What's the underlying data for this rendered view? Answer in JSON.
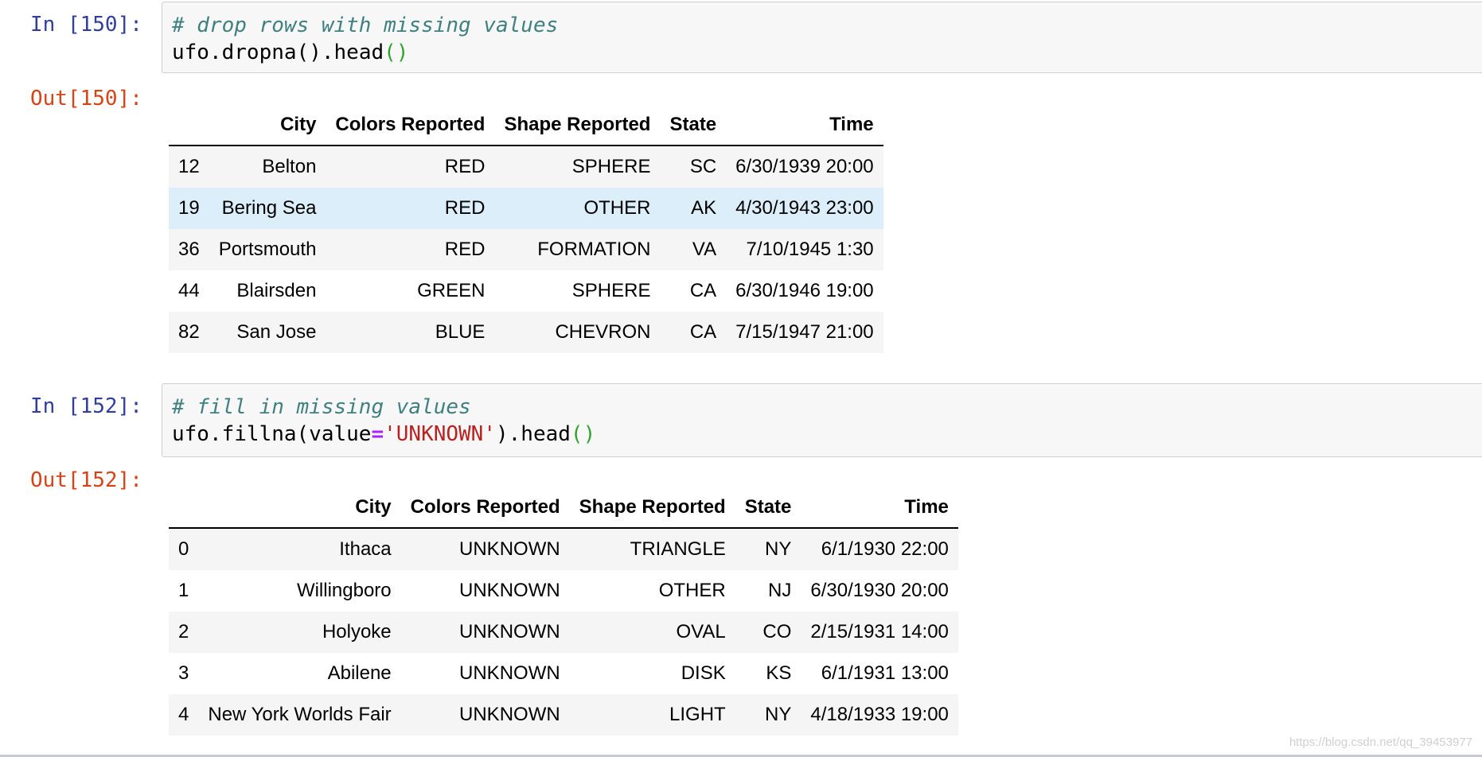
{
  "cells": [
    {
      "in_prompt": "In [150]:",
      "comment": "# drop rows with missing values",
      "code": {
        "obj": "ufo.dropna",
        "p1": "()",
        "mid": ".head",
        "p2": "()"
      },
      "out_prompt": "Out[150]:",
      "table": {
        "columns": [
          "",
          "City",
          "Colors Reported",
          "Shape Reported",
          "State",
          "Time"
        ],
        "rows": [
          [
            "12",
            "Belton",
            "RED",
            "SPHERE",
            "SC",
            "6/30/1939 20:00"
          ],
          [
            "19",
            "Bering Sea",
            "RED",
            "OTHER",
            "AK",
            "4/30/1943 23:00"
          ],
          [
            "36",
            "Portsmouth",
            "RED",
            "FORMATION",
            "VA",
            "7/10/1945 1:30"
          ],
          [
            "44",
            "Blairsden",
            "GREEN",
            "SPHERE",
            "CA",
            "6/30/1946 19:00"
          ],
          [
            "82",
            "San Jose",
            "BLUE",
            "CHEVRON",
            "CA",
            "7/15/1947 21:00"
          ]
        ],
        "highlighted_row": 1
      }
    },
    {
      "in_prompt": "In [152]:",
      "comment": "# fill in missing values",
      "code": {
        "a": "ufo.fillna(value",
        "op": "=",
        "str": "'UNKNOWN'",
        "b": ").head",
        "p": "()"
      },
      "out_prompt": "Out[152]:",
      "table": {
        "columns": [
          "",
          "City",
          "Colors Reported",
          "Shape Reported",
          "State",
          "Time"
        ],
        "rows": [
          [
            "0",
            "Ithaca",
            "UNKNOWN",
            "TRIANGLE",
            "NY",
            "6/1/1930 22:00"
          ],
          [
            "1",
            "Willingboro",
            "UNKNOWN",
            "OTHER",
            "NJ",
            "6/30/1930 20:00"
          ],
          [
            "2",
            "Holyoke",
            "UNKNOWN",
            "OVAL",
            "CO",
            "2/15/1931 14:00"
          ],
          [
            "3",
            "Abilene",
            "UNKNOWN",
            "DISK",
            "KS",
            "6/1/1931 13:00"
          ],
          [
            "4",
            "New York Worlds Fair",
            "UNKNOWN",
            "LIGHT",
            "NY",
            "4/18/1933 19:00"
          ]
        ]
      }
    }
  ],
  "watermark": "https://blog.csdn.net/qq_39453977",
  "colors": {
    "in_prompt": "#303f9f",
    "out_prompt": "#d84315",
    "comment": "#408080",
    "string": "#ba2121",
    "operator": "#aa22ff",
    "paren": "#2ea42e",
    "row_highlight": "#ddeefb"
  }
}
